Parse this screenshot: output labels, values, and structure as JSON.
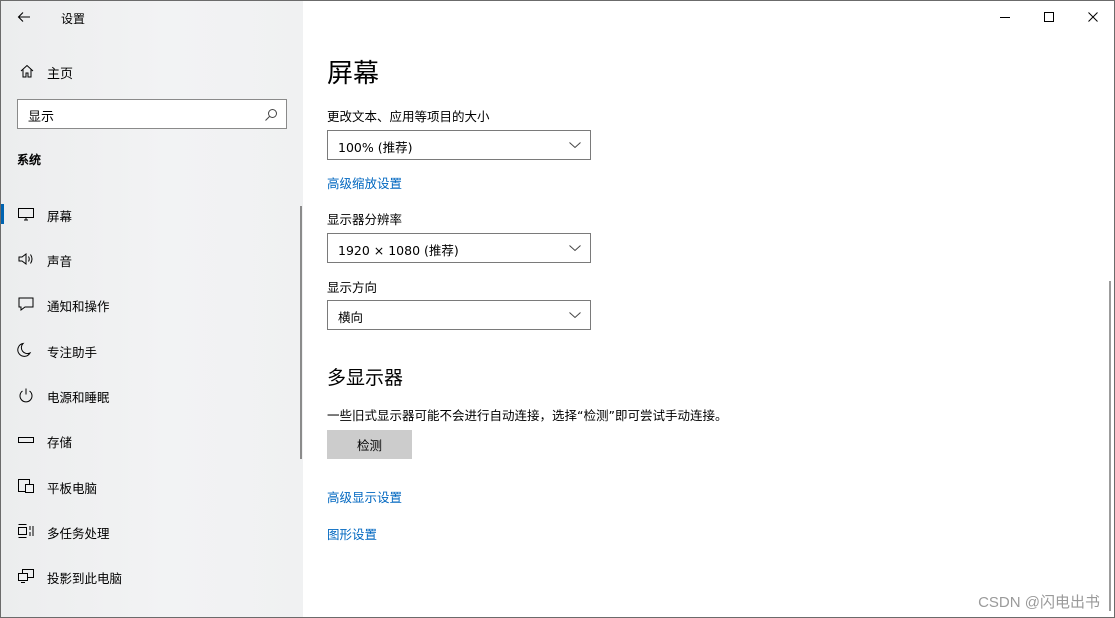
{
  "window": {
    "title": "设置",
    "controls": {
      "minimize": "minimize-icon",
      "maximize": "maximize-icon",
      "close": "close-icon"
    }
  },
  "sidebar": {
    "home_label": "主页",
    "search": {
      "value": "显示"
    },
    "section_title": "系统",
    "items": [
      {
        "label": "屏幕",
        "icon": "monitor-icon",
        "selected": true
      },
      {
        "label": "声音",
        "icon": "speaker-icon"
      },
      {
        "label": "通知和操作",
        "icon": "notification-icon"
      },
      {
        "label": "专注助手",
        "icon": "moon-icon"
      },
      {
        "label": "电源和睡眠",
        "icon": "power-icon"
      },
      {
        "label": "存储",
        "icon": "storage-icon"
      },
      {
        "label": "平板电脑",
        "icon": "tablet-icon"
      },
      {
        "label": "多任务处理",
        "icon": "multitask-icon"
      },
      {
        "label": "投影到此电脑",
        "icon": "project-icon"
      }
    ]
  },
  "main": {
    "page_title": "屏幕",
    "scale": {
      "label": "更改文本、应用等项目的大小",
      "value": "100% (推荐)"
    },
    "advanced_scaling_link": "高级缩放设置",
    "resolution": {
      "label": "显示器分辨率",
      "value": "1920 × 1080 (推荐)"
    },
    "orientation": {
      "label": "显示方向",
      "value": "横向"
    },
    "multi_display": {
      "title": "多显示器",
      "description": "一些旧式显示器可能不会进行自动连接，选择“检测”即可尝试手动连接。",
      "detect_button": "检测"
    },
    "advanced_display_link": "高级显示设置",
    "graphics_link": "图形设置"
  },
  "watermark": "CSDN @闪电出书",
  "colors": {
    "accent": "#0063b1",
    "link": "#0067c0",
    "button_bg": "#cccccc"
  }
}
